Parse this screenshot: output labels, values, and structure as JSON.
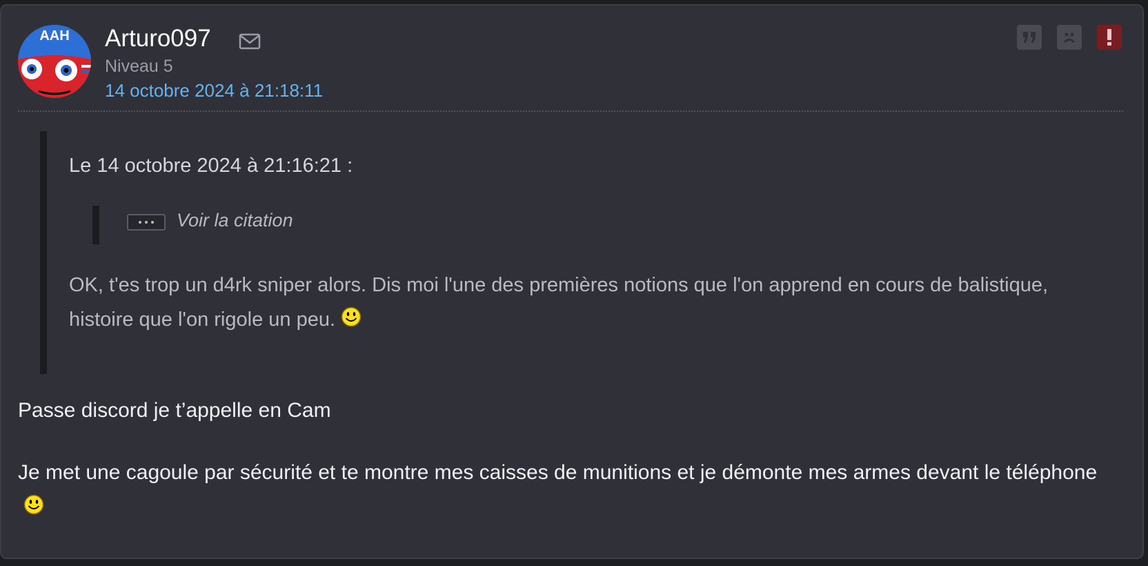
{
  "post": {
    "author": "Arturo097",
    "avatar_text": "AAH",
    "level": "Niveau 5",
    "date": "14 octobre 2024 à 21:18:11"
  },
  "actions": [
    {
      "name": "quote",
      "icon": "quote-icon"
    },
    {
      "name": "sad",
      "icon": "sad-face-icon"
    },
    {
      "name": "report",
      "icon": "alert-icon",
      "color": "#7a1d22"
    }
  ],
  "quote": {
    "header": "Le 14 octobre 2024 à 21:16:21 :",
    "nested_label": "Voir la citation",
    "body": "OK, t'es trop un d4rk sniper alors. Dis moi l'une des premières notions que l'on apprend en cours de balistique, histoire que l'on rigole un peu."
  },
  "message": {
    "paragraph1": "Passe discord je t’appelle en Cam",
    "paragraph2": "Je met une cagoule par sécurité et te montre mes caisses de munitions et je démonte mes armes devant le téléphone"
  },
  "colors": {
    "background": "#2f3038",
    "link": "#63b3f0",
    "alert": "#7a1d22"
  }
}
